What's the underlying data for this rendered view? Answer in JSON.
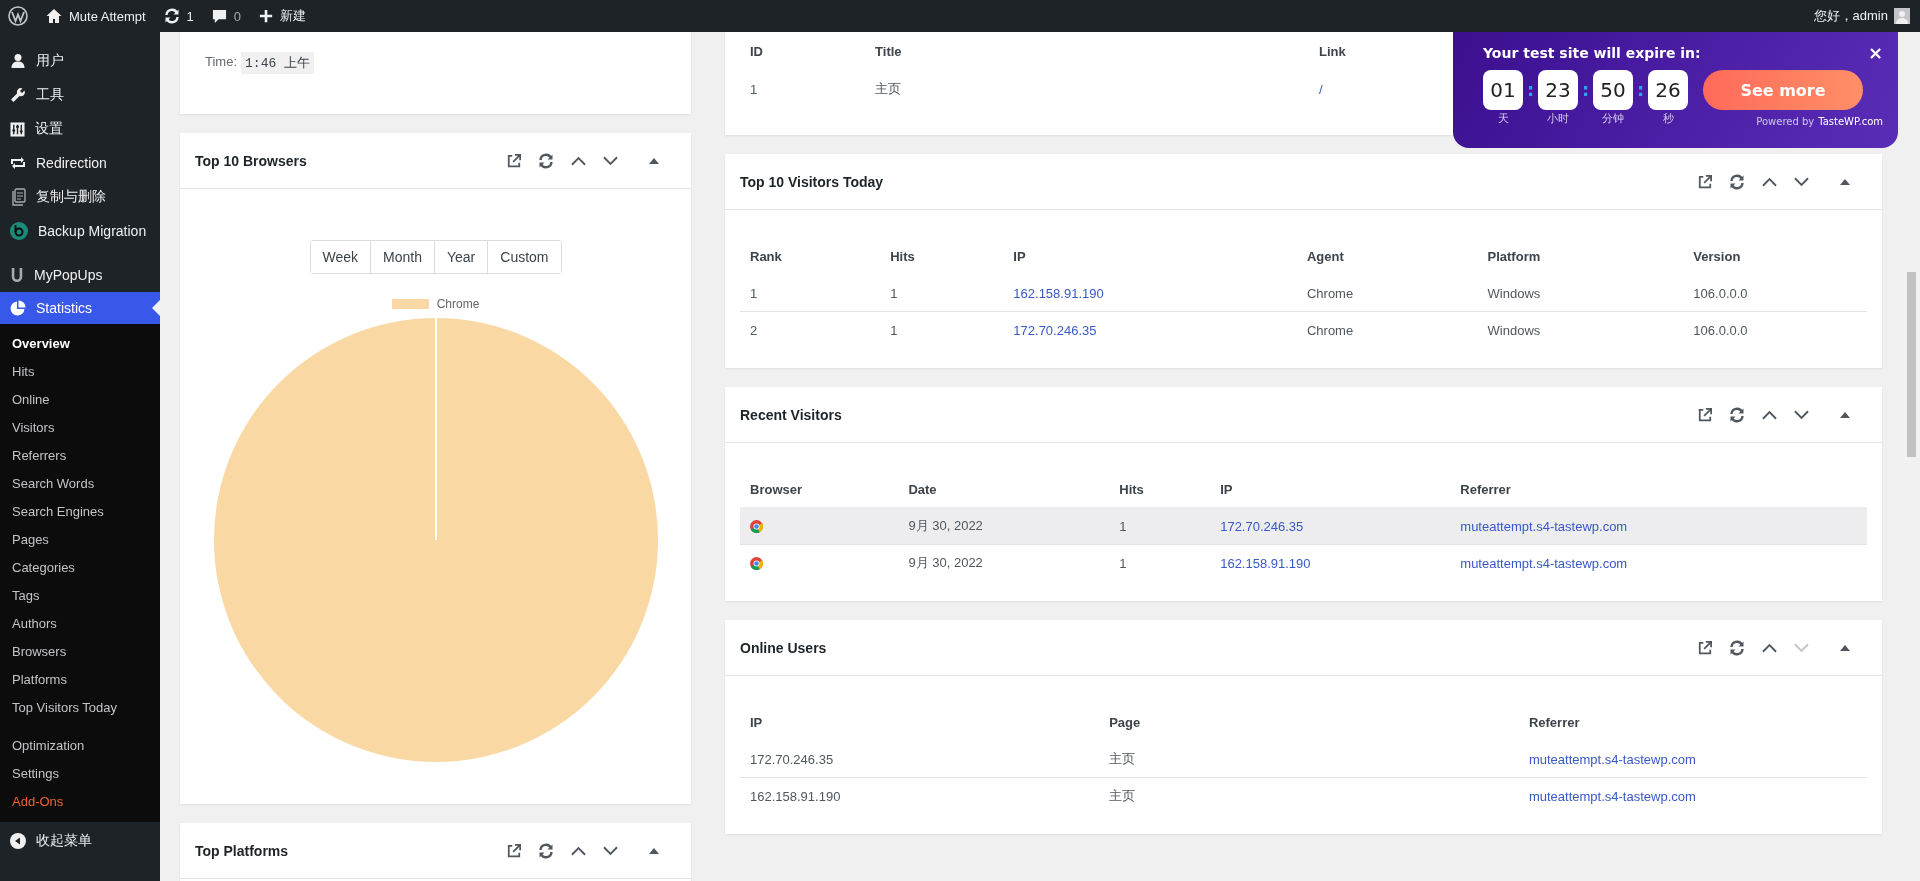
{
  "admin_bar": {
    "site_name": "Mute Attempt",
    "updates": "1",
    "comments": "0",
    "new_label": "新建",
    "greeting": "您好，admin"
  },
  "sidebar": {
    "items": [
      {
        "label": "用户",
        "selected": false
      },
      {
        "label": "工具",
        "selected": false
      },
      {
        "label": "设置",
        "selected": false
      },
      {
        "label": "Redirection",
        "selected": false
      },
      {
        "label": "复制与删除",
        "selected": false
      },
      {
        "label": "Backup Migration",
        "selected": false
      },
      {
        "label": "MyPopUps",
        "selected": false
      },
      {
        "label": "Statistics",
        "selected": true
      }
    ],
    "submenu": [
      {
        "label": "Overview",
        "selected": true,
        "kind": "normal"
      },
      {
        "label": "Hits",
        "selected": false,
        "kind": "normal"
      },
      {
        "label": "Online",
        "selected": false,
        "kind": "normal"
      },
      {
        "label": "Visitors",
        "selected": false,
        "kind": "normal"
      },
      {
        "label": "Referrers",
        "selected": false,
        "kind": "normal"
      },
      {
        "label": "Search Words",
        "selected": false,
        "kind": "normal"
      },
      {
        "label": "Search Engines",
        "selected": false,
        "kind": "normal"
      },
      {
        "label": "Pages",
        "selected": false,
        "kind": "normal"
      },
      {
        "label": "Categories",
        "selected": false,
        "kind": "normal"
      },
      {
        "label": "Tags",
        "selected": false,
        "kind": "normal"
      },
      {
        "label": "Authors",
        "selected": false,
        "kind": "normal"
      },
      {
        "label": "Browsers",
        "selected": false,
        "kind": "normal"
      },
      {
        "label": "Platforms",
        "selected": false,
        "kind": "normal"
      },
      {
        "label": "Top Visitors Today",
        "selected": false,
        "kind": "normal"
      },
      {
        "label": "Optimization",
        "selected": false,
        "kind": "spaced"
      },
      {
        "label": "Settings",
        "selected": false,
        "kind": "normal"
      },
      {
        "label": "Add-Ons",
        "selected": false,
        "kind": "highlight"
      }
    ],
    "collapse_label": "收起菜单"
  },
  "time_card": {
    "label": "Time:",
    "value": "1:46 上午"
  },
  "browsers_card": {
    "title": "Top 10 Browsers",
    "can_move_down": true,
    "ranges": [
      {
        "label": "Week",
        "selected": false
      },
      {
        "label": "Month",
        "selected": false
      },
      {
        "label": "Year",
        "selected": false
      },
      {
        "label": "Custom",
        "selected": false
      }
    ],
    "legend": [
      {
        "label": "Chrome",
        "color": "#f9d8a3"
      }
    ]
  },
  "platforms_card": {
    "title": "Top Platforms",
    "can_move_down": true
  },
  "pages_table": {
    "columns": [
      {
        "label": "ID",
        "kind": "text"
      },
      {
        "label": "Title",
        "kind": "text"
      },
      {
        "label": "Link",
        "kind": "link"
      }
    ],
    "rows": [
      {
        "cells": [
          "1",
          "主页",
          "/"
        ],
        "hovered": false
      }
    ]
  },
  "cards": [
    {
      "title": "Top 10 Visitors Today",
      "can_move_down": true,
      "columns": [
        {
          "label": "Rank",
          "kind": "text"
        },
        {
          "label": "Hits",
          "kind": "text"
        },
        {
          "label": "IP",
          "kind": "link"
        },
        {
          "label": "Agent",
          "kind": "text"
        },
        {
          "label": "Platform",
          "kind": "text"
        },
        {
          "label": "Version",
          "kind": "text"
        }
      ],
      "rows": [
        {
          "cells": [
            "1",
            "1",
            "162.158.91.190",
            "Chrome",
            "Windows",
            "106.0.0.0"
          ],
          "hovered": false
        },
        {
          "cells": [
            "2",
            "1",
            "172.70.246.35",
            "Chrome",
            "Windows",
            "106.0.0.0"
          ],
          "hovered": false
        }
      ]
    },
    {
      "title": "Recent Visitors",
      "can_move_down": true,
      "columns": [
        {
          "label": "Browser",
          "kind": "icon"
        },
        {
          "label": "Date",
          "kind": "text"
        },
        {
          "label": "Hits",
          "kind": "text"
        },
        {
          "label": "IP",
          "kind": "link"
        },
        {
          "label": "Referrer",
          "kind": "link"
        }
      ],
      "rows": [
        {
          "cells": [
            "",
            "9月 30, 2022",
            "1",
            "172.70.246.35",
            "muteattempt.s4-tastewp.com"
          ],
          "hovered": true
        },
        {
          "cells": [
            "",
            "9月 30, 2022",
            "1",
            "162.158.91.190",
            "muteattempt.s4-tastewp.com"
          ],
          "hovered": false
        }
      ]
    },
    {
      "title": "Online Users",
      "can_move_down": false,
      "columns": [
        {
          "label": "IP",
          "kind": "text"
        },
        {
          "label": "Page",
          "kind": "text"
        },
        {
          "label": "Referrer",
          "kind": "link"
        }
      ],
      "rows": [
        {
          "cells": [
            "172.70.246.35",
            "主页",
            "muteattempt.s4-tastewp.com"
          ],
          "hovered": false
        },
        {
          "cells": [
            "162.158.91.190",
            "主页",
            "muteattempt.s4-tastewp.com"
          ],
          "hovered": false
        }
      ]
    }
  ],
  "expiry_popup": {
    "title": "Your test site will expire in:",
    "units": [
      {
        "value": "01",
        "label": "天"
      },
      {
        "value": "23",
        "label": "小时"
      },
      {
        "value": "50",
        "label": "分钟"
      },
      {
        "value": "26",
        "label": "秒"
      }
    ],
    "separator": ":",
    "button": "See more",
    "powered_prefix": "Powered by",
    "powered_brand": "TasteWP.com",
    "close": "×"
  }
}
